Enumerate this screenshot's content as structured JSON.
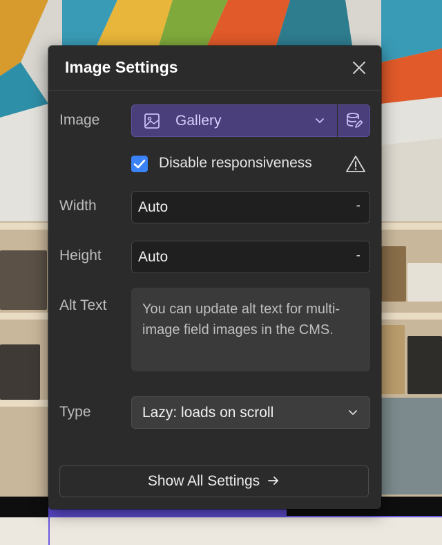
{
  "panel": {
    "title": "Image Settings"
  },
  "fields": {
    "image": {
      "label": "Image",
      "value": "Gallery",
      "icon": "image-icon"
    },
    "disable_responsiveness": {
      "label": "Disable responsiveness",
      "checked": true
    },
    "width": {
      "label": "Width",
      "value": "Auto",
      "unit": "-"
    },
    "height": {
      "label": "Height",
      "value": "Auto",
      "unit": "-"
    },
    "alt_text": {
      "label": "Alt Text",
      "message": "You can update alt text for multi-image field images in the CMS."
    },
    "type": {
      "label": "Type",
      "value": "Lazy: loads on scroll"
    }
  },
  "footer": {
    "show_all_label": "Show All Settings"
  },
  "colors": {
    "panel_bg": "#2b2b2b",
    "accent_purple": "#4a3f7a",
    "checkbox_blue": "#3b82f6"
  }
}
